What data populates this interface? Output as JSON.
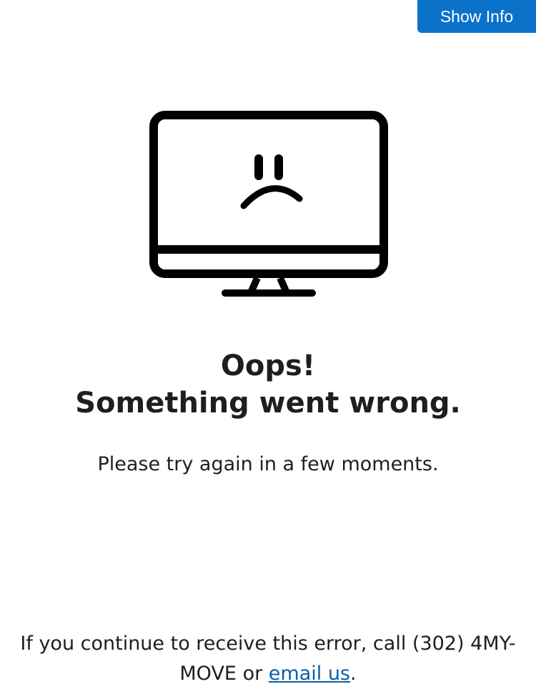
{
  "header": {
    "show_info_label": "Show Info"
  },
  "illustration": {
    "icon": "sad-monitor-icon"
  },
  "error": {
    "title": "Oops!",
    "subtitle": "Something went wrong.",
    "message": "Please try again in a few moments."
  },
  "contact": {
    "prefix": "If you continue to receive this error, call (302) 4MY-MOVE or ",
    "link_label": "email us",
    "suffix": "."
  },
  "colors": {
    "accent": "#0a72c9",
    "link": "#0a5fa8",
    "text": "#1e1e1e"
  }
}
